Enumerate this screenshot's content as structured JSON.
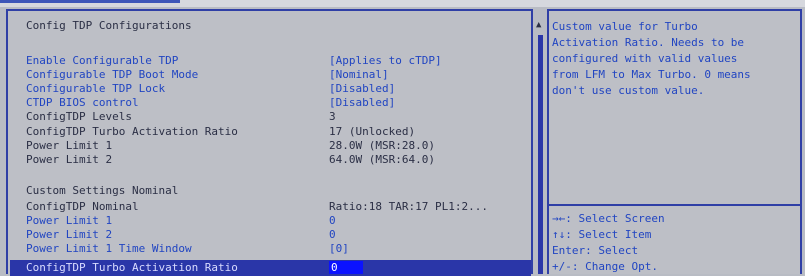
{
  "panel_title": "Config TDP Configurations",
  "settings": [
    {
      "label": "Enable Configurable TDP",
      "value": "[Applies to cTDP]"
    },
    {
      "label": "Configurable TDP Boot Mode",
      "value": "[Nominal]"
    },
    {
      "label": "Configurable TDP Lock",
      "value": "[Disabled]"
    },
    {
      "label": "CTDP BIOS control",
      "value": "[Disabled]"
    },
    {
      "label": "ConfigTDP Levels",
      "value": "3"
    },
    {
      "label": "ConfigTDP Turbo Activation Ratio",
      "value": "17 (Unlocked)"
    },
    {
      "label": "Power Limit 1",
      "value": "28.0W (MSR:28.0)"
    },
    {
      "label": "Power Limit 2",
      "value": "64.0W (MSR:64.0)"
    }
  ],
  "custom_section_title": "Custom Settings Nominal",
  "custom_settings": [
    {
      "label": "ConfigTDP Nominal",
      "value": "Ratio:18 TAR:17 PL1:2..."
    },
    {
      "label": "Power Limit 1",
      "value": "0"
    },
    {
      "label": "Power Limit 2",
      "value": "0"
    },
    {
      "label": "Power Limit 1 Time Window",
      "value": "[0]"
    }
  ],
  "selected_setting": {
    "label": "ConfigTDP Turbo Activation Ratio",
    "value": "0"
  },
  "help_text": "Custom value for Turbo\nActivation Ratio. Needs to be\nconfigured with valid values\nfrom LFM to Max Turbo. 0 means\ndon't use custom value.",
  "key_help": [
    "→←: Select Screen",
    "↑↓: Select Item",
    "Enter: Select",
    "+/-: Change Opt."
  ],
  "scroll_up_icon": "▲",
  "colors": {
    "accent_blue": "#2145c2",
    "highlight": "#2a36a8",
    "edit_box": "#0b12ff",
    "background": "#bdbfc6"
  }
}
